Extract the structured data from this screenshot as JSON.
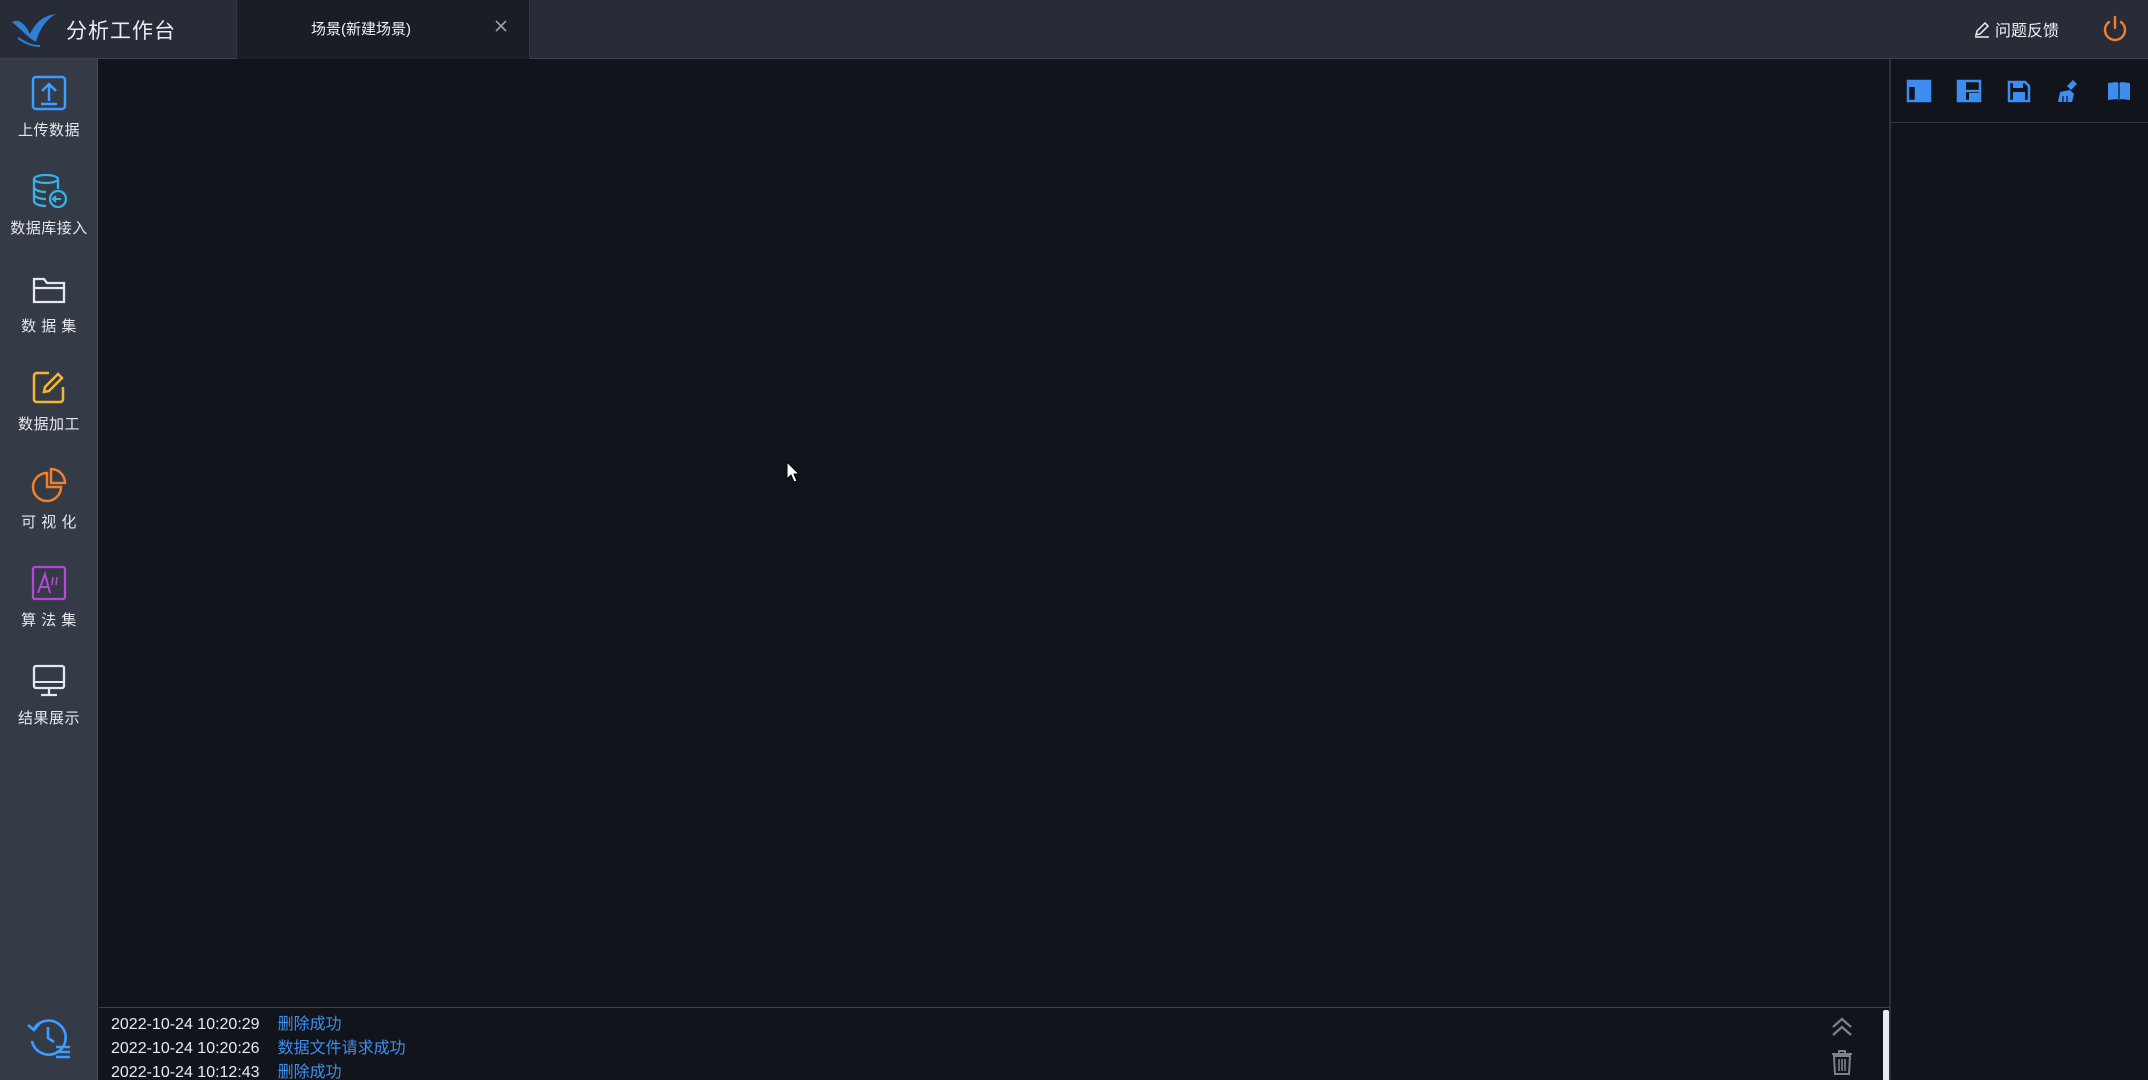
{
  "app": {
    "title": "分析工作台",
    "feedback_label": "问题反馈"
  },
  "tab": {
    "label": "场景(新建场景)"
  },
  "sidebar": {
    "items": [
      {
        "label": "上传数据",
        "icon": "upload-icon",
        "color": "#3d9cff"
      },
      {
        "label": "数据库接入",
        "icon": "database-icon",
        "color": "#35b3e8"
      },
      {
        "label": "数 据 集",
        "icon": "folder-icon",
        "color": "#e4e7ec"
      },
      {
        "label": "数据加工",
        "icon": "edit-icon",
        "color": "#f5b431"
      },
      {
        "label": "可 视 化",
        "icon": "pie-chart-icon",
        "color": "#f07f2e"
      },
      {
        "label": "算 法 集",
        "icon": "algorithm-icon",
        "color": "#b546d6"
      },
      {
        "label": "结果展示",
        "icon": "monitor-icon",
        "color": "#e4e7ec"
      }
    ],
    "history_icon": "history-icon"
  },
  "right_toolbar": {
    "icons": [
      "layout-icon",
      "panel-layout-icon",
      "save-icon",
      "clear-icon",
      "book-icon"
    ],
    "color": "#3d8df0"
  },
  "log": {
    "entries": [
      {
        "time": "2022-10-24 10:20:29",
        "message": "删除成功"
      },
      {
        "time": "2022-10-24 10:20:26",
        "message": "数据文件请求成功"
      },
      {
        "time": "2022-10-24 10:12:43",
        "message": "删除成功"
      }
    ]
  },
  "colors": {
    "accent": "#3d8df0",
    "power": "#f07f2e",
    "background": "#12141c",
    "sidebar": "#343a46",
    "topbar": "#272c36"
  }
}
